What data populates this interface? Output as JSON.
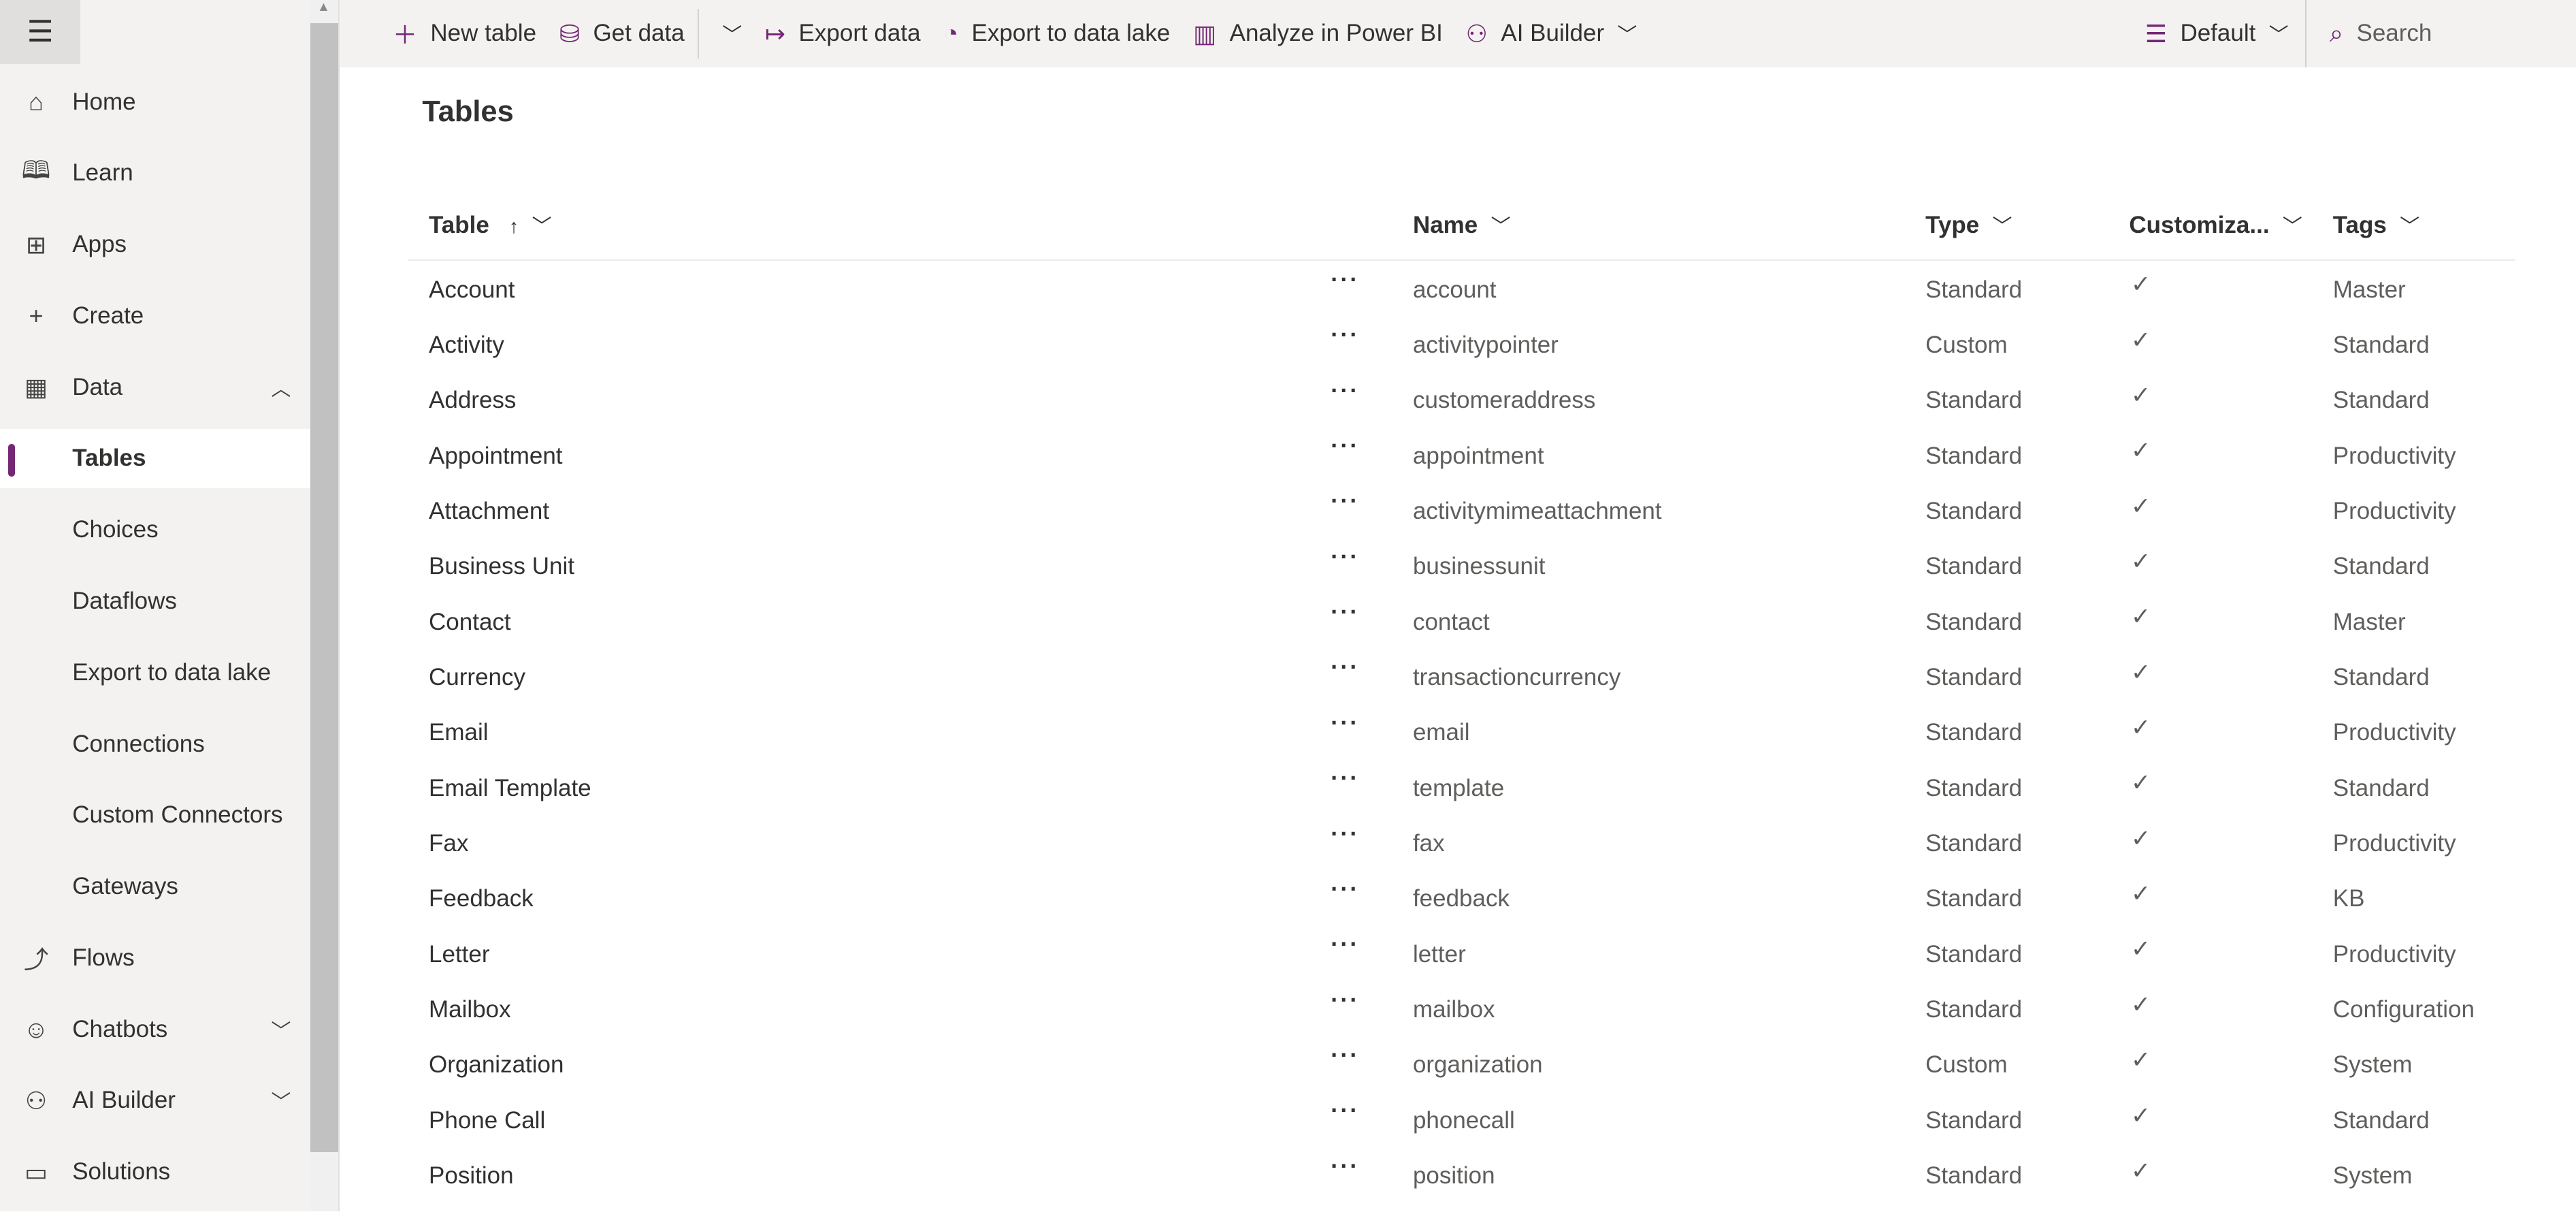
{
  "sidebar": {
    "items": [
      {
        "label": "Home",
        "icon": "home-icon",
        "glyph": "⌂"
      },
      {
        "label": "Learn",
        "icon": "book-icon",
        "glyph": "🕮"
      },
      {
        "label": "Apps",
        "icon": "apps-icon",
        "glyph": "⊞"
      },
      {
        "label": "Create",
        "icon": "plus-icon",
        "glyph": "+"
      },
      {
        "label": "Data",
        "icon": "table-icon",
        "glyph": "▦",
        "chev": "︿"
      },
      {
        "label": "Tables",
        "sub": true,
        "selected": true
      },
      {
        "label": "Choices",
        "sub": true
      },
      {
        "label": "Dataflows",
        "sub": true
      },
      {
        "label": "Export to data lake",
        "sub": true
      },
      {
        "label": "Connections",
        "sub": true
      },
      {
        "label": "Custom Connectors",
        "sub": true
      },
      {
        "label": "Gateways",
        "sub": true
      },
      {
        "label": "Flows",
        "icon": "flow-icon",
        "glyph": "⤴"
      },
      {
        "label": "Chatbots",
        "icon": "bot-icon",
        "glyph": "☺",
        "chev": "﹀"
      },
      {
        "label": "AI Builder",
        "icon": "ai-icon",
        "glyph": "⚇",
        "chev": "﹀"
      },
      {
        "label": "Solutions",
        "icon": "solutions-icon",
        "glyph": "▭"
      }
    ]
  },
  "toolbar": {
    "new_table": "New table",
    "get_data": "Get data",
    "export_data": "Export data",
    "export_lake": "Export to data lake",
    "analyze": "Analyze in Power BI",
    "ai_builder": "AI Builder",
    "view": "Default",
    "search": "Search"
  },
  "page": {
    "title": "Tables"
  },
  "columns": {
    "table": "Table",
    "name": "Name",
    "type": "Type",
    "custom": "Customiza...",
    "tags": "Tags"
  },
  "rows": [
    [
      "Account",
      "account",
      "Standard",
      "Master"
    ],
    [
      "Activity",
      "activitypointer",
      "Custom",
      "Standard"
    ],
    [
      "Address",
      "customeraddress",
      "Standard",
      "Standard"
    ],
    [
      "Appointment",
      "appointment",
      "Standard",
      "Productivity"
    ],
    [
      "Attachment",
      "activitymimeattachment",
      "Standard",
      "Productivity"
    ],
    [
      "Business Unit",
      "businessunit",
      "Standard",
      "Standard"
    ],
    [
      "Contact",
      "contact",
      "Standard",
      "Master"
    ],
    [
      "Currency",
      "transactioncurrency",
      "Standard",
      "Standard"
    ],
    [
      "Email",
      "email",
      "Standard",
      "Productivity"
    ],
    [
      "Email Template",
      "template",
      "Standard",
      "Standard"
    ],
    [
      "Fax",
      "fax",
      "Standard",
      "Productivity"
    ],
    [
      "Feedback",
      "feedback",
      "Standard",
      "KB"
    ],
    [
      "Letter",
      "letter",
      "Standard",
      "Productivity"
    ],
    [
      "Mailbox",
      "mailbox",
      "Standard",
      "Configuration"
    ],
    [
      "Organization",
      "organization",
      "Custom",
      "System"
    ],
    [
      "Phone Call",
      "phonecall",
      "Standard",
      "Standard"
    ],
    [
      "Position",
      "position",
      "Standard",
      "System"
    ]
  ],
  "accent": "#742774"
}
